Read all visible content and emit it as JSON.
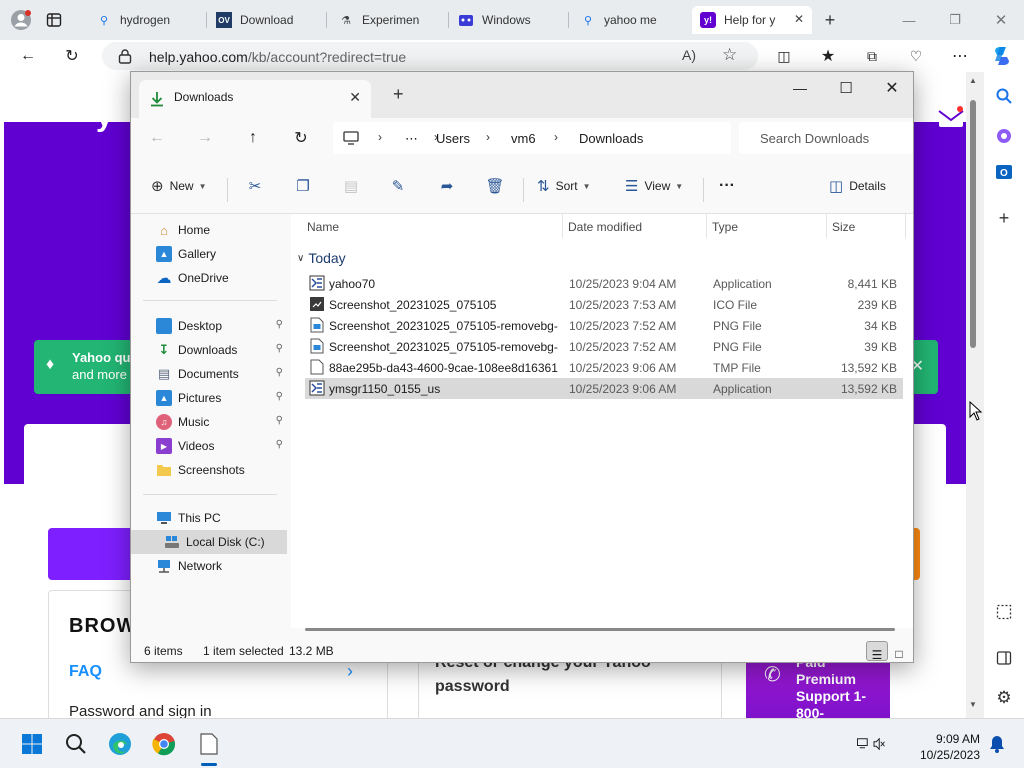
{
  "browser": {
    "tabs": [
      {
        "label": "hydrogen",
        "icon": "search-icon"
      },
      {
        "label": "Download",
        "icon": "ov-logo",
        "icon_text": "OV"
      },
      {
        "label": "Experimen",
        "icon": "flask-icon"
      },
      {
        "label": "Windows",
        "icon": "puzzle-icon"
      },
      {
        "label": "yahoo me",
        "icon": "search-icon"
      },
      {
        "label": "Help for y",
        "icon": "yahoo-icon",
        "icon_text": "y!"
      }
    ],
    "url_host": "help.yahoo.com",
    "url_path": "/kb/account?redirect=true"
  },
  "webpage": {
    "logo_text": "y",
    "banner_line1": "Yahoo qu",
    "banner_line2": "and more",
    "browse_title": "BROW",
    "faq_label": "FAQ",
    "faq_item": "Password and sign in",
    "reset_text": "Reset or change your Yahoo password",
    "paid_support": "Paid Premium Support 1-800-"
  },
  "explorer": {
    "tab_label": "Downloads",
    "breadcrumbs": [
      "Users",
      "vm6",
      "Downloads"
    ],
    "search_placeholder": "Search Downloads",
    "toolbar": {
      "new_label": "New",
      "sort_label": "Sort",
      "view_label": "View",
      "more_label": "···",
      "details_label": "Details"
    },
    "sidebar": {
      "quick": [
        {
          "label": "Home",
          "icon": "home-icon"
        },
        {
          "label": "Gallery",
          "icon": "gallery-icon"
        },
        {
          "label": "OneDrive",
          "icon": "cloud-icon"
        }
      ],
      "pinned": [
        {
          "label": "Desktop",
          "icon": "desktop-icon"
        },
        {
          "label": "Downloads",
          "icon": "download-icon"
        },
        {
          "label": "Documents",
          "icon": "documents-icon"
        },
        {
          "label": "Pictures",
          "icon": "pictures-icon"
        },
        {
          "label": "Music",
          "icon": "music-icon"
        },
        {
          "label": "Videos",
          "icon": "videos-icon"
        },
        {
          "label": "Screenshots",
          "icon": "folder-icon"
        }
      ],
      "devices": [
        {
          "label": "This PC",
          "icon": "pc-icon"
        },
        {
          "label": "Local Disk (C:)",
          "icon": "disk-icon"
        },
        {
          "label": "Network",
          "icon": "network-icon"
        }
      ]
    },
    "columns": {
      "name": "Name",
      "date": "Date modified",
      "type": "Type",
      "size": "Size"
    },
    "group_label": "Today",
    "files": [
      {
        "name": "yahoo70",
        "date": "10/25/2023 9:04 AM",
        "type": "Application",
        "size": "8,441 KB",
        "icon": "app-icon"
      },
      {
        "name": "Screenshot_20231025_075105",
        "date": "10/25/2023 7:53 AM",
        "type": "ICO File",
        "size": "239 KB",
        "icon": "ico-file-icon"
      },
      {
        "name": "Screenshot_20231025_075105-removebg-...",
        "date": "10/25/2023 7:52 AM",
        "type": "PNG File",
        "size": "34 KB",
        "icon": "png-file-icon"
      },
      {
        "name": "Screenshot_20231025_075105-removebg-...",
        "date": "10/25/2023 7:52 AM",
        "type": "PNG File",
        "size": "39 KB",
        "icon": "png-file-icon"
      },
      {
        "name": "88ae295b-da43-4600-9cae-108ee8d16361...",
        "date": "10/25/2023 9:06 AM",
        "type": "TMP File",
        "size": "13,592 KB",
        "icon": "tmp-file-icon"
      },
      {
        "name": "ymsgr1150_0155_us",
        "date": "10/25/2023 9:06 AM",
        "type": "Application",
        "size": "13,592 KB",
        "icon": "app-icon"
      }
    ],
    "status": {
      "items": "6 items",
      "selected": "1 item selected",
      "size": "13.2 MB"
    }
  },
  "taskbar": {
    "time": "9:09 AM",
    "date": "10/25/2023"
  },
  "colors": {
    "yahoo_purple": "#6001d2",
    "accent_blue": "#005fb8",
    "selection_gray": "#d9d9d9"
  }
}
